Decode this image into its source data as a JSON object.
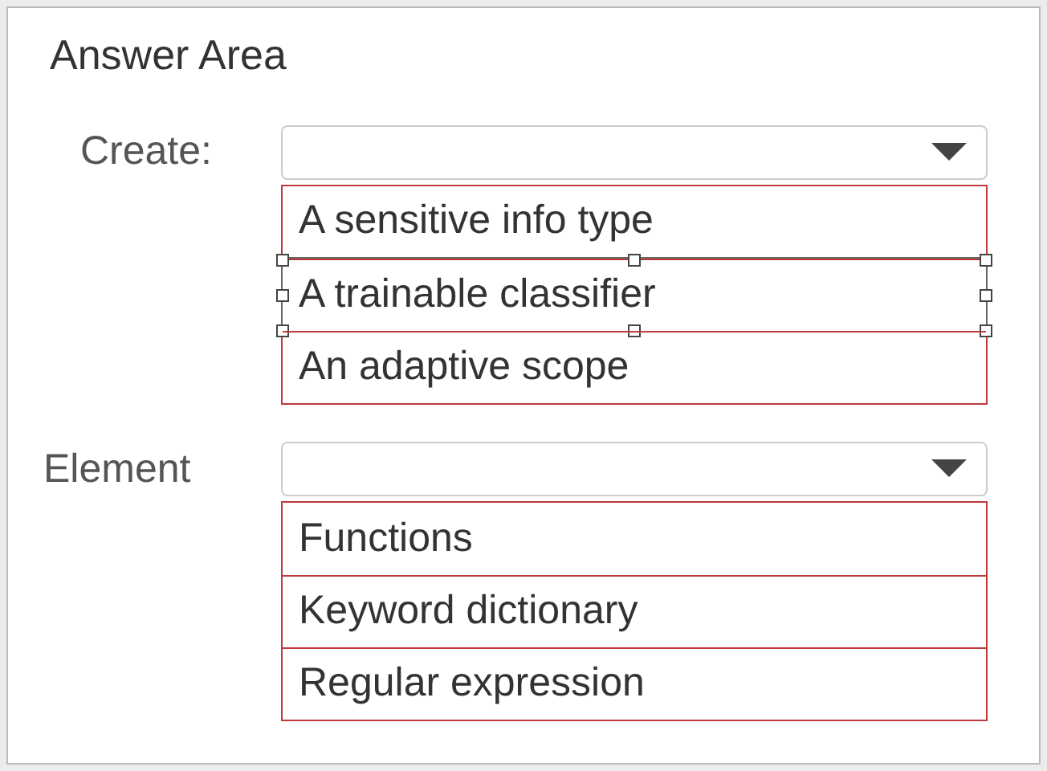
{
  "title": "Answer Area",
  "fields": [
    {
      "label": "Create:",
      "options": [
        {
          "label": "A sensitive info type",
          "selected": false
        },
        {
          "label": "A trainable classifier",
          "selected": true
        },
        {
          "label": "An adaptive scope",
          "selected": false
        }
      ]
    },
    {
      "label": "Element",
      "options": [
        {
          "label": "Functions",
          "selected": false
        },
        {
          "label": "Keyword dictionary",
          "selected": false
        },
        {
          "label": "Regular expression",
          "selected": false
        }
      ]
    }
  ]
}
